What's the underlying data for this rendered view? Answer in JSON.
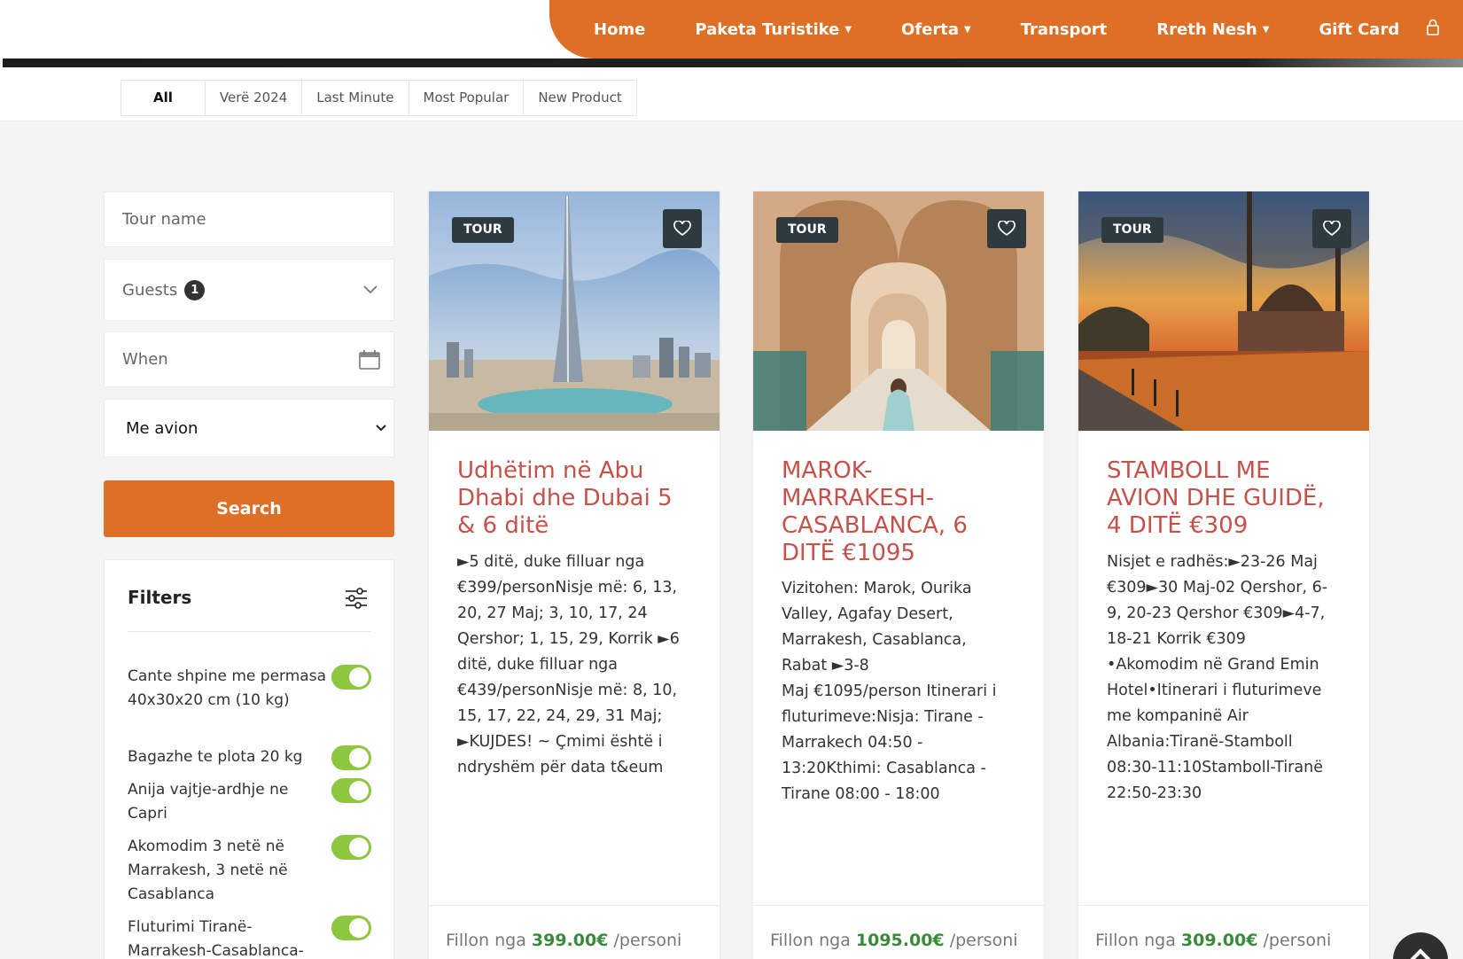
{
  "nav": {
    "items": [
      {
        "label": "Home",
        "caret": false
      },
      {
        "label": "Paketa Turistike",
        "caret": true
      },
      {
        "label": "Oferta",
        "caret": true
      },
      {
        "label": "Transport",
        "caret": false
      },
      {
        "label": "Rreth Nesh",
        "caret": true
      },
      {
        "label": "Gift Card",
        "caret": false
      }
    ],
    "accent": "#de6f26"
  },
  "tabs": [
    "All",
    "Verë 2024",
    "Last Minute",
    "Most Popular",
    "New Product"
  ],
  "sidebar": {
    "tour_name_placeholder": "Tour name",
    "guests_label": "Guests",
    "guests_count": "1",
    "when_placeholder": "When",
    "transport_selected": "Me avion",
    "search_label": "Search",
    "filters_title": "Filters",
    "filters": [
      "Cante shpine me permasa 40x30x20 cm (10 kg)",
      "Bagazhe te plota 20 kg",
      "Anija vajtje-ardhje ne Capri",
      "Akomodim 3 netë në Marrakesh, 3 netë në Casablanca",
      "Fluturimi Tiranë-Marrakesh-Casablanca-"
    ]
  },
  "cards": [
    {
      "badge": "TOUR",
      "title": "Udhëtim në Abu Dhabi dhe Dubai 5 & 6 ditë",
      "description": "►5 ditë, duke filluar nga €399/personNisje më: 6, 13, 20, 27 Maj; 3, 10, 17, 24 Qershor; 1, 15, 29, Korrik ►6 ditë, duke filluar nga €439/personNisje më: 8, 10, 15, 17, 22, 24, 29, 31 Maj; ►KUJDES! ~ Çmimi është i ndryshëm për data t&eum",
      "price_prefix": "Fillon nga",
      "price": "399.00€",
      "price_suffix": "/personi"
    },
    {
      "badge": "TOUR",
      "title": "MAROK- MARRAKESH- CASABLANCA, 6 DITË €1095",
      "description": "Vizitohen: Marok, Ourika Valley, Agafay Desert, Marrakesh, Casablanca, Rabat ►3-8\nMaj €1095/person Itinerari i fluturimeve:Nisja: Tirane - Marrakech 04:50 - 13:20Kthimi: Casablanca - Tirane 08:00 - 18:00",
      "price_prefix": "Fillon nga",
      "price": "1095.00€",
      "price_suffix": "/personi"
    },
    {
      "badge": "TOUR",
      "title": "STAMBOLL ME AVION DHE GUIDË, 4 DITË €309",
      "description": "Nisjet e radhës:►23-26 Maj €309►30 Maj-02 Qershor, 6-9, 20-23 Qershor €309►4-7, 18-21 Korrik €309 •Akomodim në Grand Emin Hotel•Itinerari i fluturimeve me kompaninë Air Albania:Tiranë-Stamboll 08:30-11:10Stamboll-Tiranë 22:50-23:30",
      "price_prefix": "Fillon nga",
      "price": "309.00€",
      "price_suffix": "/personi"
    }
  ]
}
